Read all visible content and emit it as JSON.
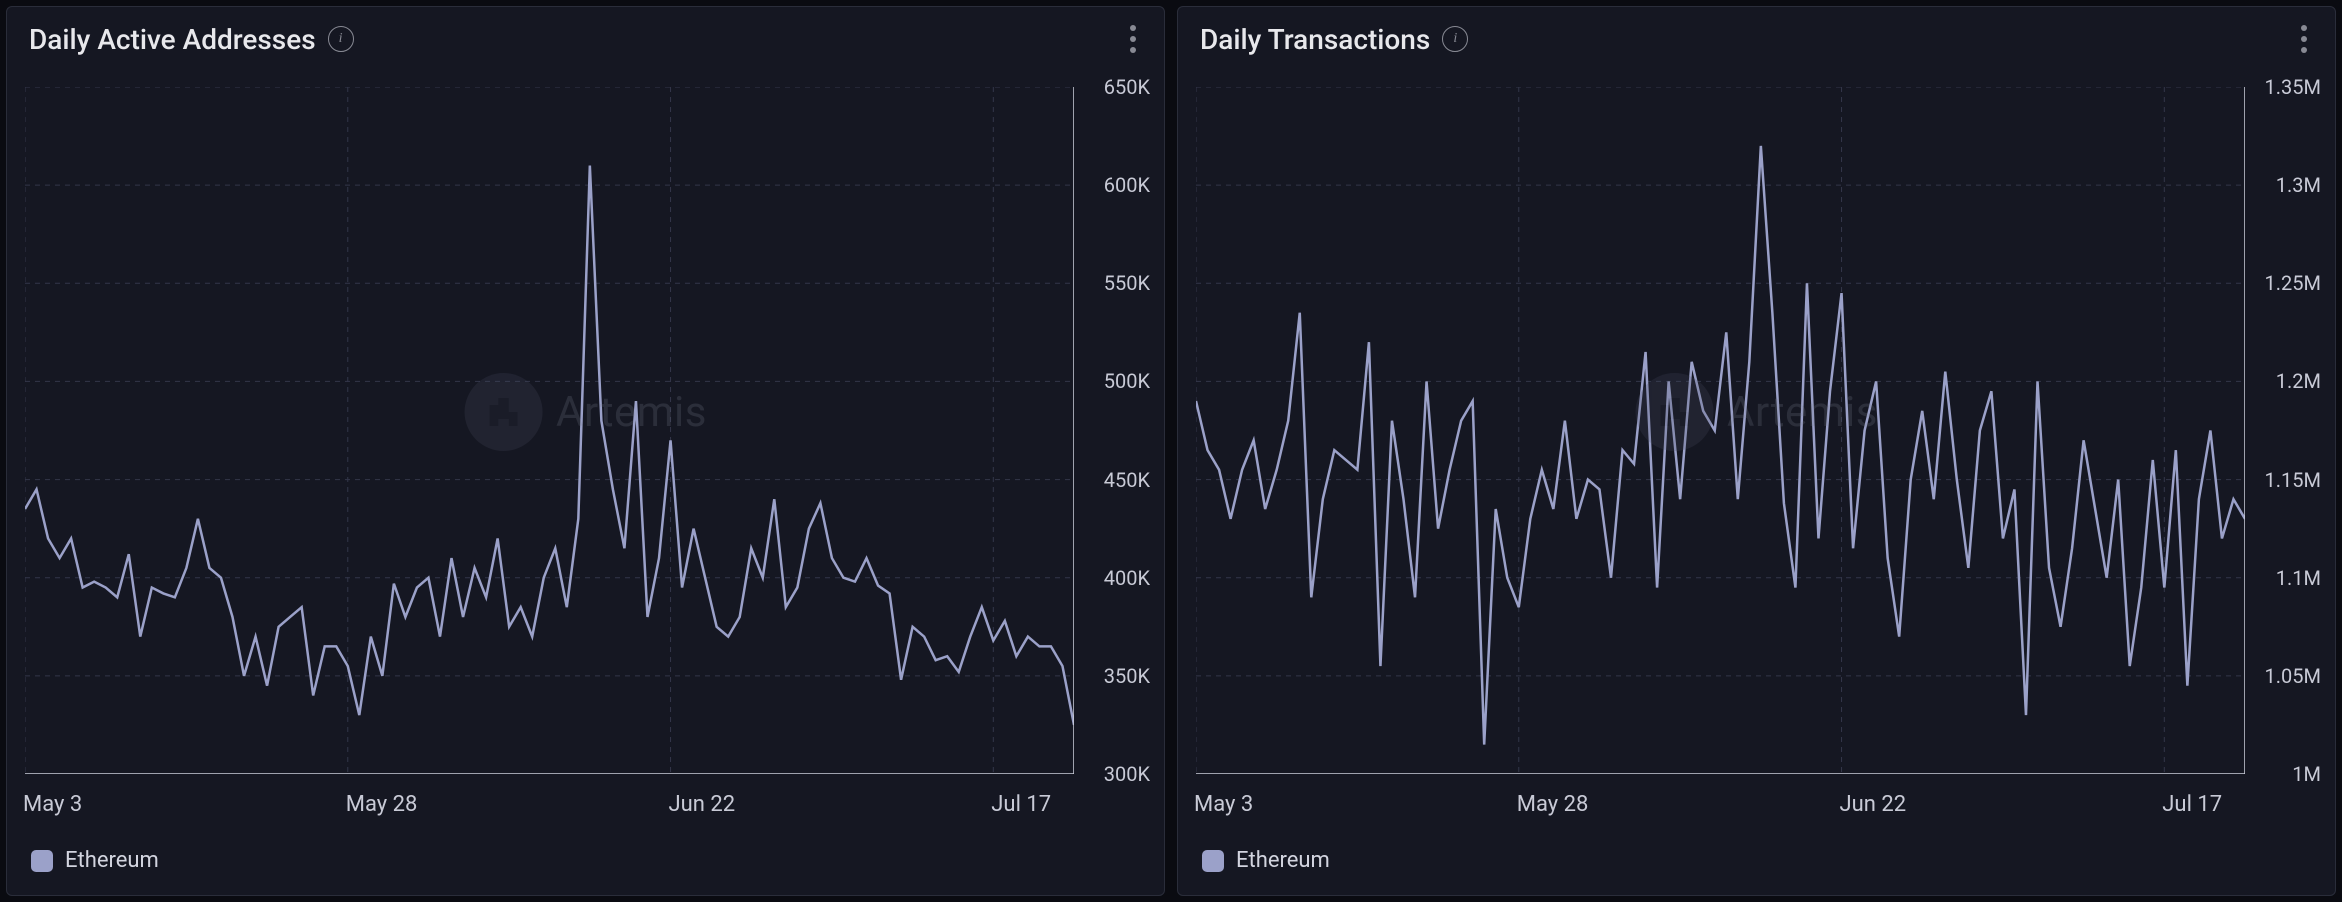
{
  "panels": [
    {
      "title": "Daily Active Addresses",
      "legend": "Ethereum",
      "watermark": "Artemis"
    },
    {
      "title": "Daily Transactions",
      "legend": "Ethereum",
      "watermark": "Artemis"
    }
  ],
  "chart_data": [
    {
      "type": "line",
      "title": "Daily Active Addresses",
      "xlabel": "",
      "ylabel": "",
      "ylim": [
        300000,
        650000
      ],
      "x_ticks": [
        "May 3",
        "May 28",
        "Jun 22",
        "Jul 17"
      ],
      "y_ticks": [
        300000,
        350000,
        400000,
        450000,
        500000,
        550000,
        600000,
        650000
      ],
      "y_tick_labels": [
        "300K",
        "350K",
        "400K",
        "450K",
        "500K",
        "550K",
        "600K",
        "650K"
      ],
      "grid": true,
      "legend_position": "bottom-left",
      "series": [
        {
          "name": "Ethereum",
          "color": "#9ba1c9",
          "values": [
            435000,
            445000,
            420000,
            410000,
            420000,
            395000,
            398000,
            395000,
            390000,
            412000,
            370000,
            395000,
            392000,
            390000,
            405000,
            430000,
            405000,
            400000,
            380000,
            350000,
            370000,
            345000,
            375000,
            380000,
            385000,
            340000,
            365000,
            365000,
            355000,
            330000,
            370000,
            350000,
            397000,
            380000,
            395000,
            400000,
            370000,
            410000,
            380000,
            405000,
            390000,
            420000,
            375000,
            385000,
            370000,
            400000,
            415000,
            385000,
            430000,
            610000,
            480000,
            445000,
            415000,
            490000,
            380000,
            410000,
            470000,
            395000,
            425000,
            400000,
            375000,
            370000,
            380000,
            415000,
            400000,
            440000,
            385000,
            395000,
            425000,
            438000,
            410000,
            400000,
            398000,
            410000,
            396000,
            392000,
            348000,
            375000,
            370000,
            358000,
            360000,
            352000,
            370000,
            385000,
            368000,
            378000,
            360000,
            370000,
            365000,
            365000,
            355000,
            325000
          ]
        }
      ]
    },
    {
      "type": "line",
      "title": "Daily Transactions",
      "xlabel": "",
      "ylabel": "",
      "ylim": [
        1000000,
        1350000
      ],
      "x_ticks": [
        "May 3",
        "May 28",
        "Jun 22",
        "Jul 17"
      ],
      "y_ticks": [
        1000000,
        1050000,
        1100000,
        1150000,
        1200000,
        1250000,
        1300000,
        1350000
      ],
      "y_tick_labels": [
        "1M",
        "1.05M",
        "1.1M",
        "1.15M",
        "1.2M",
        "1.25M",
        "1.3M",
        "1.35M"
      ],
      "grid": true,
      "legend_position": "bottom-left",
      "series": [
        {
          "name": "Ethereum",
          "color": "#9ba1c9",
          "values": [
            1190000,
            1165000,
            1155000,
            1130000,
            1155000,
            1170000,
            1135000,
            1155000,
            1180000,
            1235000,
            1090000,
            1140000,
            1165000,
            1160000,
            1155000,
            1220000,
            1055000,
            1180000,
            1140000,
            1090000,
            1200000,
            1125000,
            1155000,
            1180000,
            1190000,
            1015000,
            1135000,
            1100000,
            1085000,
            1130000,
            1155000,
            1135000,
            1180000,
            1130000,
            1150000,
            1145000,
            1100000,
            1165000,
            1158000,
            1215000,
            1095000,
            1200000,
            1140000,
            1210000,
            1185000,
            1175000,
            1225000,
            1140000,
            1210000,
            1320000,
            1235000,
            1138000,
            1095000,
            1250000,
            1120000,
            1195000,
            1245000,
            1115000,
            1175000,
            1200000,
            1110000,
            1070000,
            1150000,
            1185000,
            1140000,
            1205000,
            1150000,
            1105000,
            1175000,
            1195000,
            1120000,
            1145000,
            1030000,
            1200000,
            1105000,
            1075000,
            1115000,
            1170000,
            1135000,
            1100000,
            1150000,
            1055000,
            1095000,
            1160000,
            1095000,
            1165000,
            1045000,
            1140000,
            1175000,
            1120000,
            1140000,
            1130000
          ]
        }
      ]
    }
  ]
}
